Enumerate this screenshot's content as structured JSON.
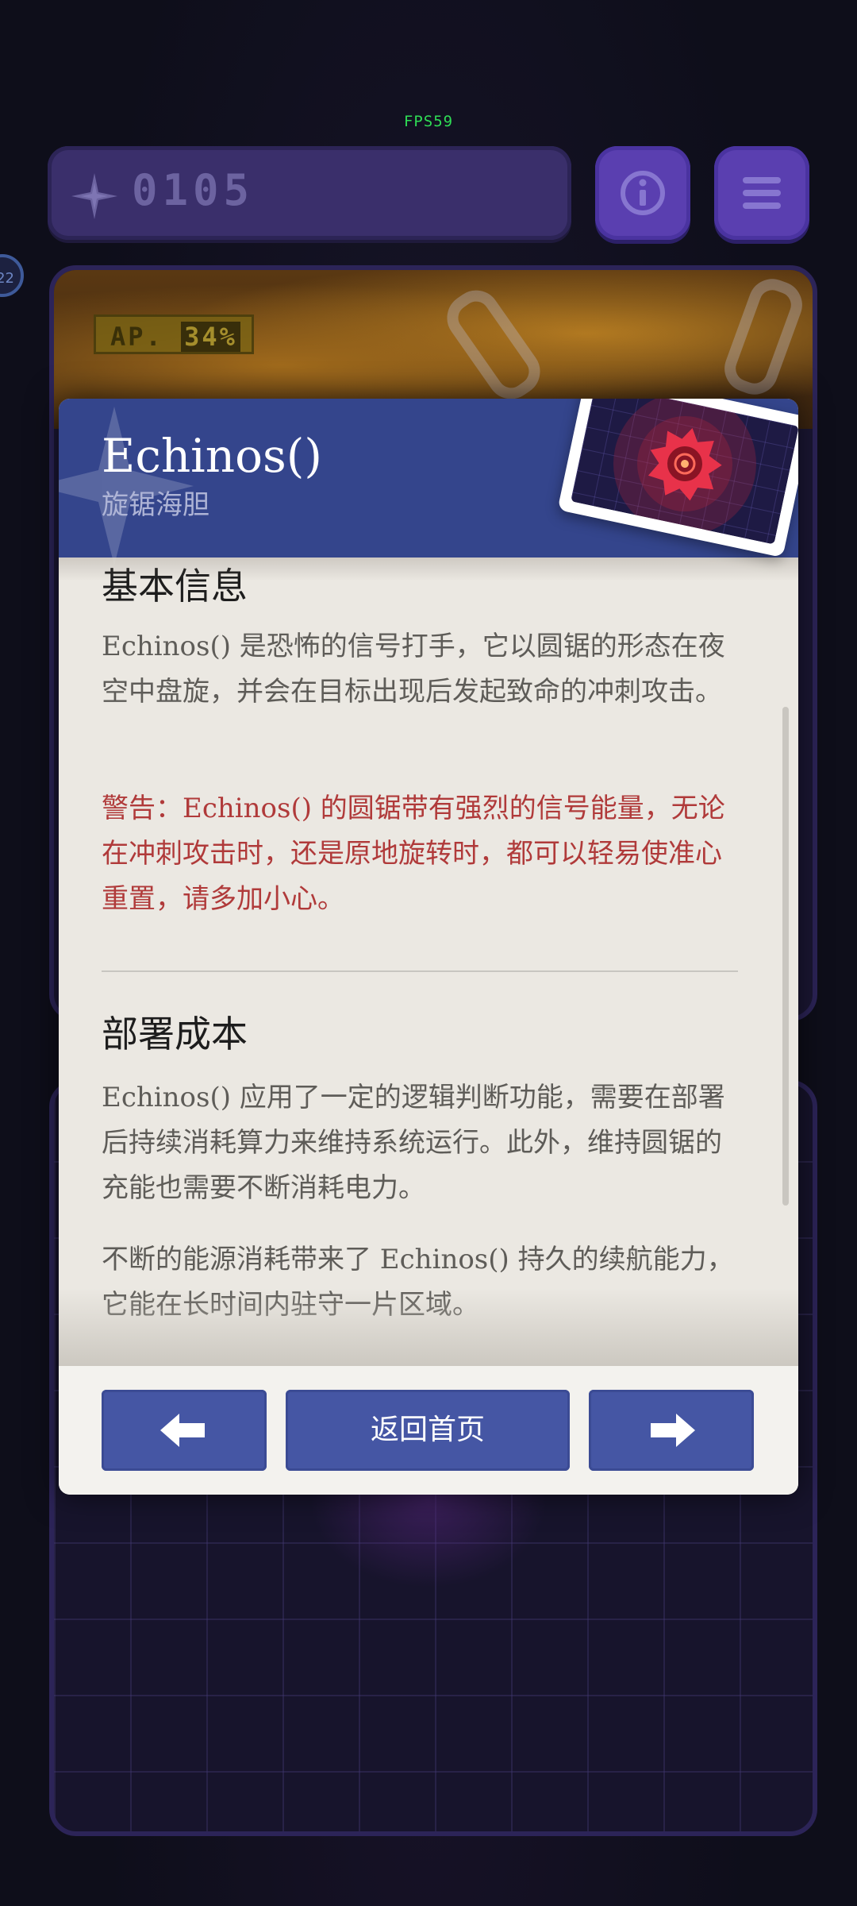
{
  "hud": {
    "fps": "FPS59",
    "score": "0105",
    "side_badge": "22",
    "ap_label": "AP.",
    "ap_value": "34%"
  },
  "icons": {
    "score": "compass-star-icon",
    "info": "info-icon",
    "menu": "hamburger-menu-icon",
    "prev": "arrow-left-icon",
    "next": "arrow-right-icon"
  },
  "modal": {
    "title": "Echinos()",
    "subtitle": "旋锯海胆",
    "sections": [
      {
        "heading": "基本信息",
        "paragraphs": [
          "Echinos() 是恐怖的信号打手，它以圆锯的形态在夜空中盘旋，并会在目标出现后发起致命的冲刺攻击。"
        ],
        "warning": "警告：Echinos() 的圆锯带有强烈的信号能量，无论在冲刺攻击时，还是原地旋转时，都可以轻易使准心重置，请多加小心。"
      },
      {
        "heading": "部署成本",
        "paragraphs": [
          "Echinos() 应用了一定的逻辑判断功能，需要在部署后持续消耗算力来维持系统运行。此外，维持圆锯的充能也需要不断消耗电力。",
          "不断的能源消耗带来了 Echinos() 持久的续航能力，它能在长时间内驻守一片区域。"
        ]
      }
    ],
    "footer": {
      "home_label": "返回首页"
    }
  },
  "colors": {
    "header_blue": "#34458c",
    "button_blue": "#4556a4",
    "warning_red": "#b03a3a",
    "panel_purple": "#3a2f6b",
    "fps_green": "#2fdc55"
  }
}
